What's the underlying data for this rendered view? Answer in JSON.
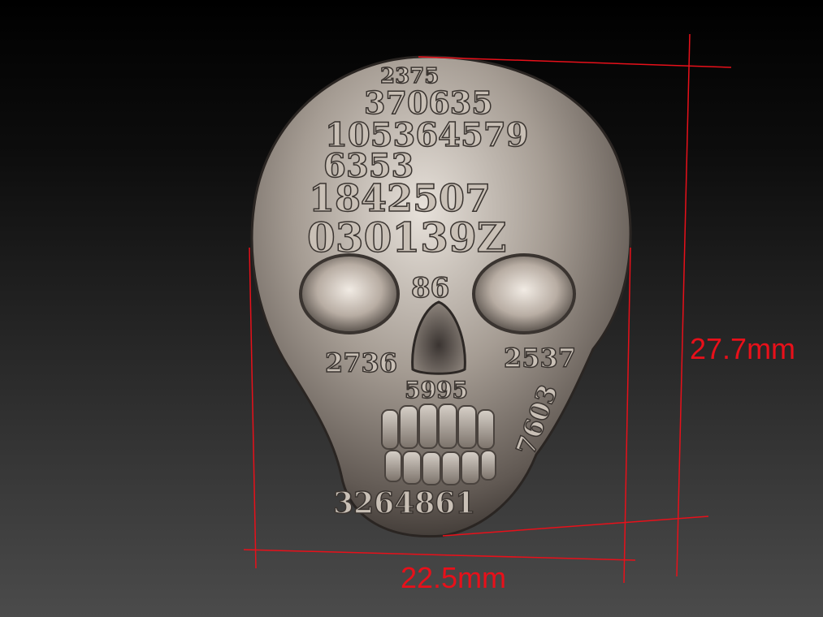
{
  "image": {
    "subject": "skull-ring-render",
    "colors": {
      "background_top": "#000000",
      "background_bottom": "#4b4b4b",
      "metal_light": "#e7e1da",
      "metal_mid": "#9c948c",
      "metal_dark": "#3e3935",
      "dimension_line": "#e8101a"
    }
  },
  "dimensions": {
    "height_label": "27.7mm",
    "width_label": "22.5mm"
  },
  "engraved_digits": {
    "row1": "2375",
    "row2": "370635",
    "row3": "105364579",
    "row4": "6353",
    "row5": "1842507",
    "row6": "030139Z",
    "cheek_left": "2736",
    "cheek_right": "2537",
    "nose": "86",
    "upper_lip": "5995",
    "chin": "3264861",
    "jaw_right": "7603"
  }
}
